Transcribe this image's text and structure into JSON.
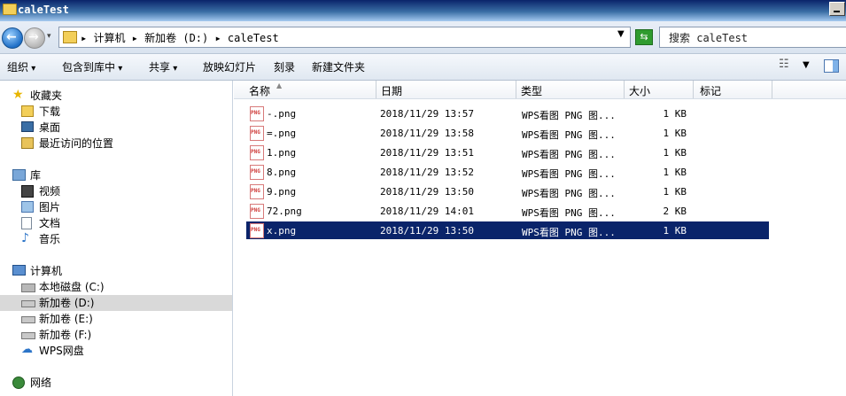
{
  "window": {
    "title": "caleTest"
  },
  "address": {
    "path": "▸ 计算机 ▸ 新加卷 (D:) ▸ caleTest",
    "search_placeholder": "搜索 caleTest"
  },
  "toolbar": {
    "organize": "组织",
    "include_library": "包含到库中",
    "share": "共享",
    "slideshow": "放映幻灯片",
    "burn": "刻录",
    "new_folder": "新建文件夹"
  },
  "nav": {
    "favorites": "收藏夹",
    "downloads": "下载",
    "desktop": "桌面",
    "recent": "最近访问的位置",
    "libraries": "库",
    "videos": "视频",
    "pictures": "图片",
    "documents": "文档",
    "music": "音乐",
    "computer": "计算机",
    "drive_c": "本地磁盘 (C:)",
    "drive_d": "新加卷 (D:)",
    "drive_e": "新加卷 (E:)",
    "drive_f": "新加卷 (F:)",
    "wps": "WPS网盘",
    "network": "网络"
  },
  "columns": {
    "name": "名称",
    "date": "日期",
    "type": "类型",
    "size": "大小",
    "tags": "标记"
  },
  "files": [
    {
      "name": "-.png",
      "date": "2018/11/29 13:57",
      "type": "WPS看图 PNG 图...",
      "size": "1 KB"
    },
    {
      "name": "=.png",
      "date": "2018/11/29 13:58",
      "type": "WPS看图 PNG 图...",
      "size": "1 KB"
    },
    {
      "name": "1.png",
      "date": "2018/11/29 13:51",
      "type": "WPS看图 PNG 图...",
      "size": "1 KB"
    },
    {
      "name": "8.png",
      "date": "2018/11/29 13:52",
      "type": "WPS看图 PNG 图...",
      "size": "1 KB"
    },
    {
      "name": "9.png",
      "date": "2018/11/29 13:50",
      "type": "WPS看图 PNG 图...",
      "size": "1 KB"
    },
    {
      "name": "72.png",
      "date": "2018/11/29 14:01",
      "type": "WPS看图 PNG 图...",
      "size": "2 KB"
    },
    {
      "name": "x.png",
      "date": "2018/11/29 13:50",
      "type": "WPS看图 PNG 图...",
      "size": "1 KB"
    }
  ]
}
